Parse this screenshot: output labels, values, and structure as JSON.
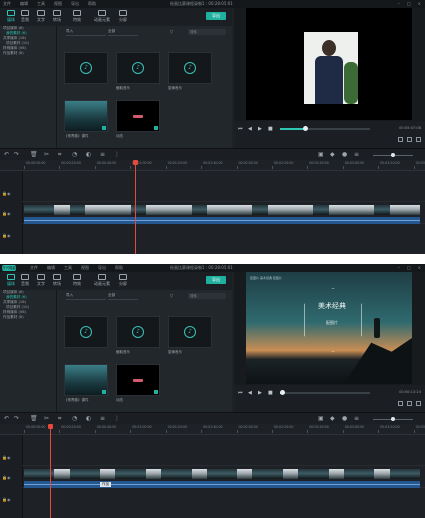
{
  "app": {
    "logo_text": "万兴喵影",
    "menus": [
      "文件",
      "编辑",
      "工具",
      "视图",
      "导出",
      "帮助"
    ],
    "title_top": "绘画比赛课程录制1 : 00:28:05:01",
    "title_bottom": "绘画比赛课程录制1 : 00:28:05:01",
    "window_controls": [
      "–",
      "□",
      "×"
    ]
  },
  "toolbar": {
    "items": [
      "媒体",
      "音频",
      "文字",
      "转场",
      "特效",
      "动画元素",
      "分屏"
    ],
    "import_label": "导出"
  },
  "folders": [
    "项目媒体 (6)",
    "我的素材 (6)",
    "共享媒体 (16)",
    "项目素材 (10)",
    "样例媒体 (56)",
    "作品素材 (6)"
  ],
  "filter": {
    "sort_label": "导入",
    "group_label": "全部",
    "filter_icon": "filter-icon",
    "search_placeholder": "搜索"
  },
  "tiles": [
    {
      "label": "",
      "kind": "audio"
    },
    {
      "label": "截取音乐",
      "kind": "audio"
    },
    {
      "label": "旋律音乐",
      "kind": "audio"
    },
    {
      "label": "《常青藤》课件",
      "kind": "video"
    },
    {
      "label": "动态",
      "kind": "title"
    }
  ],
  "preview": {
    "time_top": "00:05:07:08",
    "time_bottom": "00:00:13:24",
    "progress_top": 0.28,
    "progress_bottom": 0.02,
    "slide_title": "美术经典",
    "slide_subtitle": "配图片",
    "slide_topline": "配图片 美术经典 配图片"
  },
  "timeline": {
    "ruler_top": [
      "00:00:00:00",
      "00:00:20:00",
      "00:00:40:00",
      "00:01:00:00",
      "00:01:20:00",
      "00:01:40:00",
      "00:02:00:00",
      "00:02:20:00",
      "00:02:40:00",
      "00:03:00:00",
      "00:03:20:00",
      "00:03:40:00"
    ],
    "ruler_bottom": [
      "00:00:00:00",
      "00:00:20:00",
      "00:00:40:00",
      "00:01:00:00",
      "00:01:20:00",
      "00:01:40:00",
      "00:02:00:00",
      "00:02:20:00",
      "00:02:40:00",
      "00:03:00:00",
      "00:03:20:00",
      "00:03:40:00"
    ],
    "playhead_top_fraction": 0.28,
    "playhead_bottom_fraction": 0.07,
    "tooltip": "作品"
  }
}
